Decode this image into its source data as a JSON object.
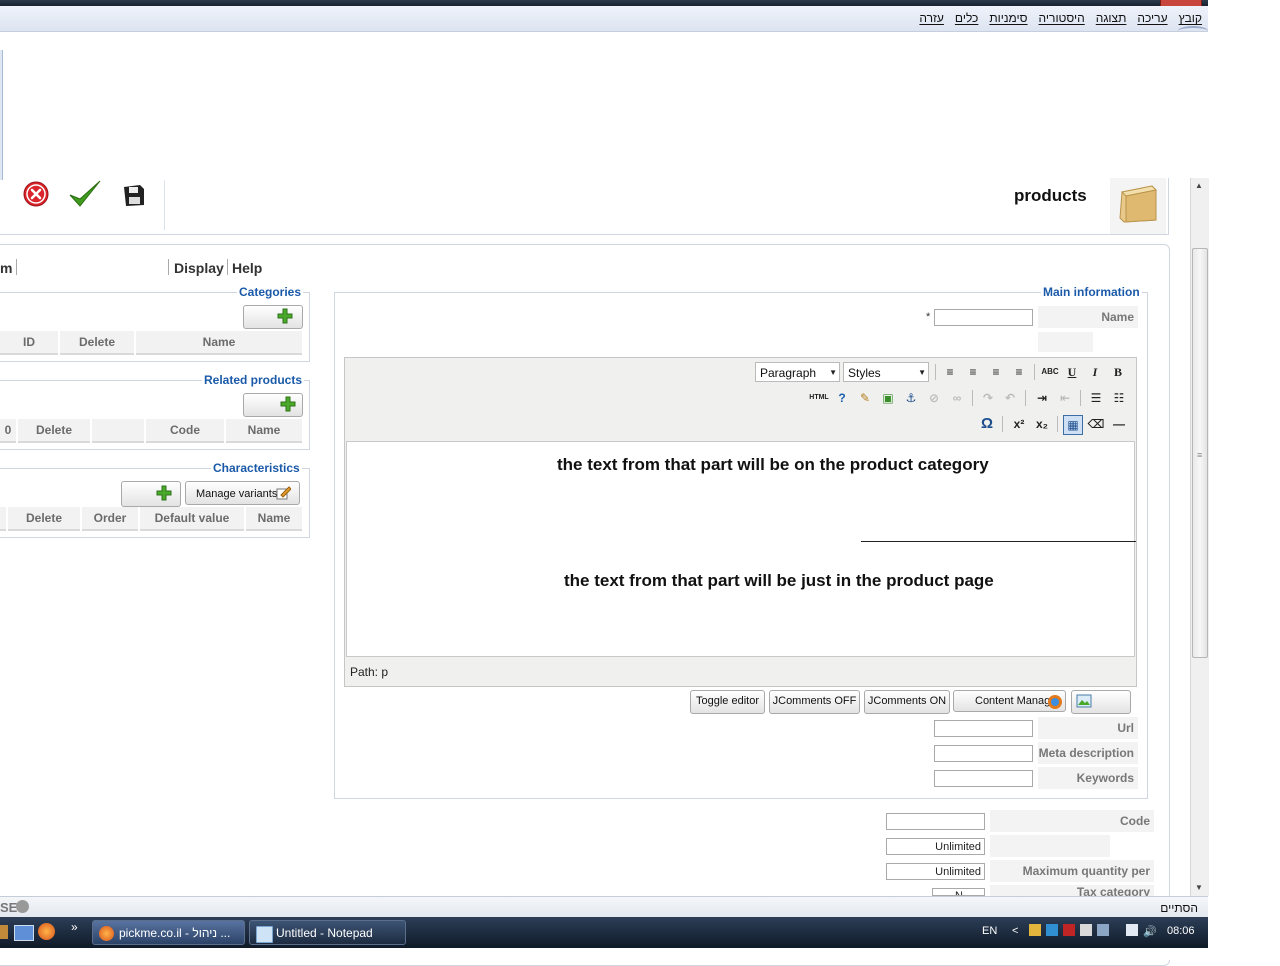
{
  "menubar": {
    "items": [
      "קובץ",
      "עריכה",
      "תצוגה",
      "היסטוריה",
      "סימניות",
      "כלים",
      "עזרה"
    ]
  },
  "header": {
    "title": "products"
  },
  "tabs": {
    "partial": "m",
    "display": "Display",
    "help": "Help"
  },
  "categories": {
    "legend": "Categories",
    "columns": [
      "ID",
      "Delete",
      "Name"
    ]
  },
  "related": {
    "legend": "Related products",
    "columns": [
      "0",
      "Delete",
      "Code",
      "Name"
    ]
  },
  "characteristics": {
    "legend": "Characteristics",
    "manage_variants": "Manage variants",
    "columns": [
      "Delete",
      "Order",
      "Default value",
      "Name"
    ]
  },
  "main_info": {
    "legend": "Main information",
    "name_label": "Name",
    "required_mark": "*",
    "editor": {
      "format_select": "Paragraph",
      "styles_select": "Styles",
      "html_button": "HTML",
      "line1": "the text from that part will be on the product category",
      "line2": "the text from that part will be just in the product page",
      "path": "Path: p"
    },
    "buttons": {
      "toggle_editor": "Toggle editor",
      "jcomments_off": "JComments OFF",
      "jcomments_on": "JComments ON",
      "content_manager": "Content Manager"
    },
    "url_label": "Url",
    "meta_label": "Meta description",
    "keywords_label": "Keywords"
  },
  "details": {
    "code_label": "Code",
    "unlimited_1": "Unlimited",
    "unlimited_2": "Unlimited",
    "max_qty_label": "Maximum quantity per order",
    "tax_label": "Tax category",
    "tax_value": "N"
  },
  "statusbar": {
    "left_text": "SE",
    "right_text": "הסתיים"
  },
  "taskbar": {
    "task1": "pickme.co.il - ניהול ...",
    "task2": "Untitled - Notepad",
    "lang": "EN",
    "time": "08:06",
    "chevron": "»"
  },
  "colors": {
    "legend": "#1a5aa8",
    "taskbar": "#1d2b40"
  }
}
